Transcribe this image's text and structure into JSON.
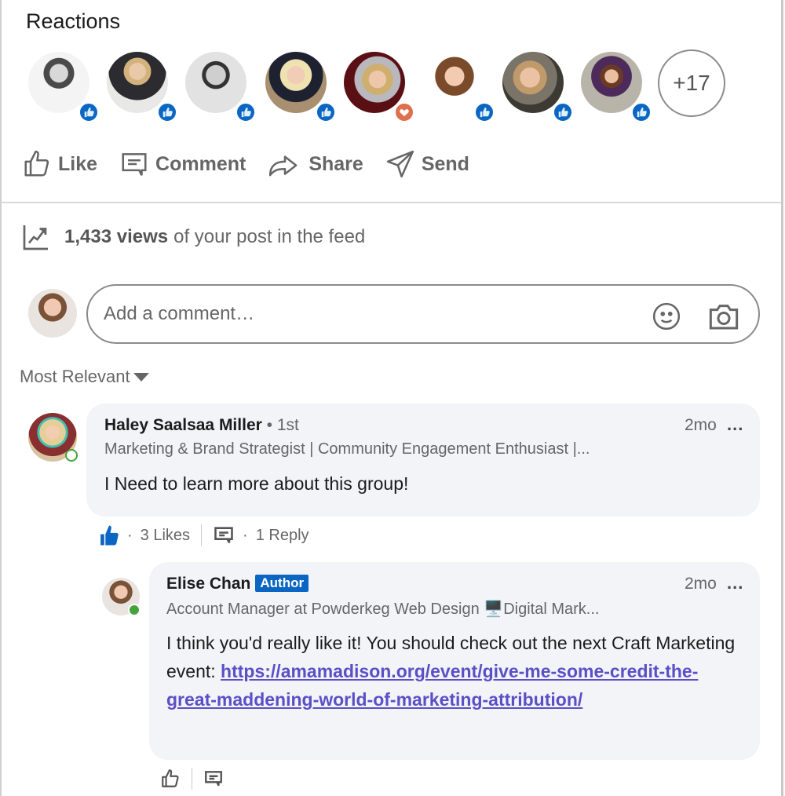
{
  "reactions": {
    "title": "Reactions",
    "people": [
      {
        "reaction": "like",
        "reaction_icon": "thumbs-up-icon",
        "avatar_tone": "grayscale"
      },
      {
        "reaction": "like",
        "reaction_icon": "thumbs-up-icon",
        "avatar_tone": "color"
      },
      {
        "reaction": "like",
        "reaction_icon": "thumbs-up-icon",
        "avatar_tone": "grayscale"
      },
      {
        "reaction": "like",
        "reaction_icon": "thumbs-up-icon",
        "avatar_tone": "color"
      },
      {
        "reaction": "love",
        "reaction_icon": "heart-icon",
        "avatar_tone": "color"
      },
      {
        "reaction": "like",
        "reaction_icon": "thumbs-up-icon",
        "avatar_tone": "color"
      },
      {
        "reaction": "like",
        "reaction_icon": "thumbs-up-icon",
        "avatar_tone": "color"
      },
      {
        "reaction": "like",
        "reaction_icon": "thumbs-up-icon",
        "avatar_tone": "color"
      }
    ],
    "more_count": "+17"
  },
  "actions": [
    {
      "label": "Like",
      "icon": "thumbs-up-outline-icon"
    },
    {
      "label": "Comment",
      "icon": "comment-icon"
    },
    {
      "label": "Share",
      "icon": "share-arrow-icon"
    },
    {
      "label": "Send",
      "icon": "send-icon"
    }
  ],
  "views": {
    "count": "1,433 views",
    "suffix": "of your post in the feed",
    "icon": "trending-chart-icon"
  },
  "comment_input": {
    "placeholder": "Add a comment…",
    "emoji_icon": "emoji-icon",
    "photo_icon": "camera-icon"
  },
  "sort": {
    "label": "Most Relevant"
  },
  "comments": [
    {
      "name": "Haley Saalsaa Miller",
      "degree": "• 1st",
      "headline": "Marketing & Brand Strategist | Community Engagement Enthusiast |...",
      "time": "2mo",
      "more": "...",
      "text": "I Need to learn more about this group!",
      "likes": "3 Likes",
      "replies": "1 Reply",
      "presence": "reachable"
    }
  ],
  "reply": {
    "name": "Elise Chan",
    "badge": "Author",
    "headline": "Account Manager at Powderkeg Web Design 🖥️Digital Mark...",
    "time": "2mo",
    "more": "...",
    "text_prefix": "I think you'd really like it! You should check out the next Craft Marketing event: ",
    "link": "https://amamadison.org/event/give-me-some-credit-the-great-maddening-world-of-marketing-attribution/",
    "presence": "online"
  },
  "colors": {
    "brand_blue": "#0a66c2",
    "love_orange": "#df704d",
    "link_purple": "#5a4fc7",
    "online_green": "#44a339",
    "bubble_bg": "#f2f4f7"
  }
}
